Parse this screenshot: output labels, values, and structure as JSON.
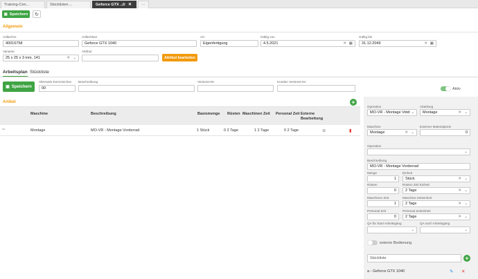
{
  "tabs": [
    {
      "label": "Training-Cen..."
    },
    {
      "label": "Stücklisten ..."
    },
    {
      "label": "Geforce GTX ..."
    }
  ],
  "tab_more": "···",
  "toolbar": {
    "save_label": "Speichern",
    "refresh_icon": "refresh-icon"
  },
  "allgemein": {
    "title": "Allgemein",
    "artikel_nr": {
      "label": "Artikel-Nr.",
      "value": "40016758"
    },
    "artikel_bez": {
      "label": "Artikel-Bez.",
      "value": "Geforce GTX 1040"
    },
    "art": {
      "label": "Art",
      "value": "Eigenfertigung"
    },
    "gueltig_von": {
      "label": "Gültig von",
      "value": "4.5.2021"
    },
    "gueltig_bis": {
      "label": "Gültig bis",
      "value": "31.12.2049"
    },
    "variante": {
      "label": "Variante",
      "value": "25 x 25 x 3 mm, 141"
    },
    "attribut": {
      "label": "Attribut",
      "value": ""
    },
    "attribut_button": "Attribut bearbeiten"
  },
  "section_tabs": [
    "Arbeitsplan",
    "Stückliste"
  ],
  "arbeitsplan": {
    "save_label": "Speichern",
    "alternativ": {
      "label": "Alternativ-Kennzeichen",
      "value": "00"
    },
    "beschreibung": {
      "label": "Beschreibung",
      "value": ""
    },
    "versions_nr": {
      "label": "Versions-Nr.",
      "value": ""
    },
    "kunden_versions_nr": {
      "label": "Kunden Versions-Nr.",
      "value": ""
    },
    "aktiv_label": "Aktiv"
  },
  "artikel": {
    "title": "Artikel",
    "columns": [
      "Maschine",
      "Beschreibung",
      "Basismenge",
      "Rüsten",
      "Maschinen Zeit",
      "Personal Zeit",
      "Externe Bearbeitung"
    ],
    "rows": [
      {
        "maschine": "Montage",
        "beschreibung": "MO-VR - Montage Vorderrad",
        "basismenge": "1 Stück",
        "ruesten": "0 2 Tage",
        "maschinen_zeit": "1 2 Tage",
        "personal_zeit": "0 2 Tage"
      }
    ]
  },
  "detail": {
    "operation": {
      "label": "Operation",
      "value": "MO-VR - Montage Vord"
    },
    "abteilung": {
      "label": "Abteilung",
      "value": "Montage"
    },
    "maschine": {
      "label": "Maschine",
      "value": "Montage"
    },
    "externer_materialpreis": {
      "label": "Externer Materialpreis",
      "value": "0"
    },
    "operation2": {
      "label": "Operation",
      "value": ""
    },
    "beschreibung": {
      "label": "Beschreibung",
      "value": "MO-VR - Montage Vorderrad"
    },
    "menge": {
      "label": "Menge",
      "value": "1"
    },
    "einheit": {
      "label": "Einheit",
      "value": "Stück"
    },
    "ruesten": {
      "label": "Rüsten",
      "value": "0"
    },
    "ruesten_zeit_einheit": {
      "label": "Rüsten Zeit Einheit",
      "value": "2 Tage"
    },
    "maschinen_zeit": {
      "label": "Maschinen Zeit",
      "value": "1"
    },
    "maschine_zeiteinheit": {
      "label": "Maschine Zeiteinheit",
      "value": "2 Tage"
    },
    "personal_zeit": {
      "label": "Personal Zeit",
      "value": "0"
    },
    "personal_zeiteinheit": {
      "label": "Personal Zeiteinheit",
      "value": "2 Tage"
    },
    "qa_start": {
      "label": "QA für Start Arbeitsgang",
      "value": ""
    },
    "qa_nach": {
      "label": "QA nach Arbeitsgang",
      "value": ""
    },
    "externe_bedienung_label": "externe Bedienung",
    "stueckliste_placeholder": "Stückliste",
    "stueckliste_item": "a - Geforce GTX 1040"
  },
  "colors": {
    "green": "#3fa443",
    "orange": "#f19a0c",
    "dark_tab": "#3c3c3c",
    "delete": "#e53935",
    "edit": "#1e88e5"
  },
  "icons": [
    "star-icon",
    "close-icon",
    "calendar-icon",
    "drag-handle-icon",
    "ban-icon",
    "trash-icon",
    "pencil-icon",
    "plus-icon",
    "floppy-icon"
  ]
}
